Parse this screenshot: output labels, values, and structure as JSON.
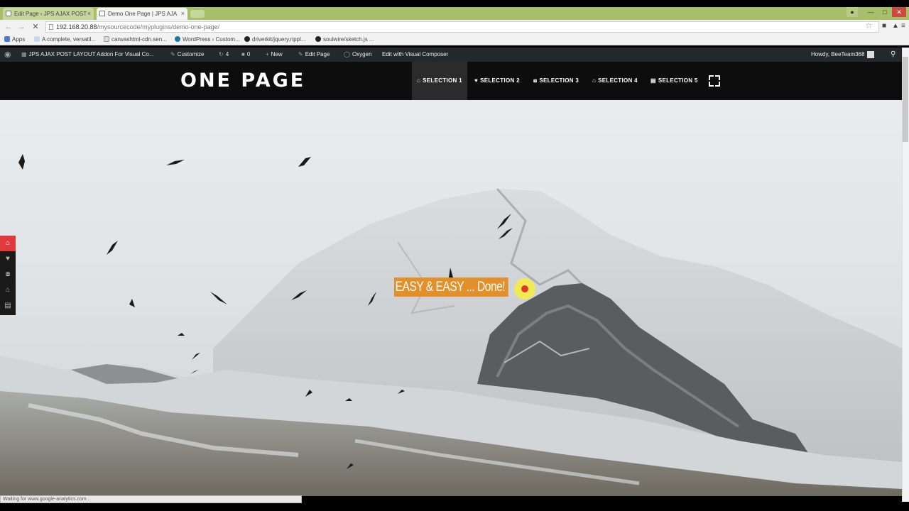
{
  "browser": {
    "tabs": [
      {
        "label": "Edit Page ‹ JPS AJAX POST",
        "close": "×"
      },
      {
        "label": "Demo One Page | JPS AJA",
        "close": "×"
      }
    ],
    "url": {
      "host": "192.168.20.88",
      "path": "/mysourcecode/myplugins/demo-one-page/"
    },
    "bookmarks": [
      "Apps",
      "A complete, versatil...",
      "canvashtml-cdn.sen...",
      "WordPress › Custom...",
      "driverkit/jquery.rippl...",
      "soulwire/sketch.js ..."
    ],
    "status": "Waiting for www.google-analytics.com..."
  },
  "adminbar": {
    "site": "JPS AJAX POST LAYOUT Addon For Visual Co...",
    "customize": "Customize",
    "updates": "4",
    "comments": "0",
    "new": "New",
    "edit_page": "Edit Page",
    "oxygen": "Oxygen",
    "visual_composer": "Edit with Visual Composer",
    "howdy": "Howdy, BeeTeam368"
  },
  "site": {
    "logo": "ONE PAGE",
    "menu": [
      "SELECTION 1",
      "SELECTION 2",
      "SELECTION 3",
      "SELECTION 4",
      "SELECTION 5"
    ],
    "tagline": "EASY & EASY ... Done!"
  },
  "colors": {
    "accent": "#e4902a",
    "side_nav_active": "#e03a3a",
    "header_bg": "#0d0d0d",
    "adminbar_bg": "#23282d"
  },
  "icons": {
    "menu": [
      "home-icon",
      "heart-icon",
      "share-icon",
      "home-icon",
      "cart-icon"
    ],
    "side_nav": [
      "home-icon",
      "heart-icon",
      "share-icon",
      "home-icon",
      "cart-icon"
    ]
  }
}
